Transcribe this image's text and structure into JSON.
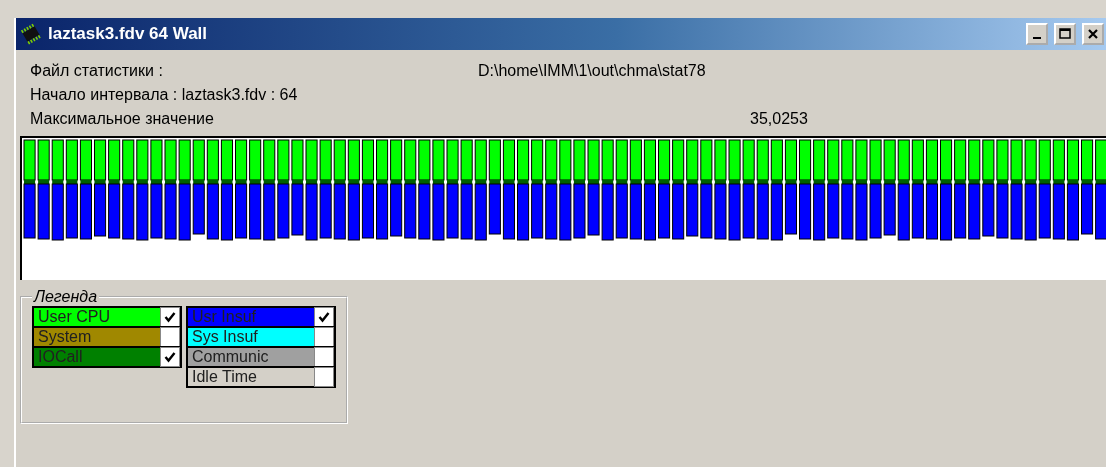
{
  "window": {
    "title": "laztask3.fdv 64 Wall"
  },
  "info": [
    {
      "kind": "pair",
      "label": "Файл статистики :",
      "value": "D:\\home\\IMM\\1\\out\\chma\\stat78"
    },
    {
      "kind": "single",
      "label": "Начало интервала : laztask3.fdv : 64"
    },
    {
      "kind": "far",
      "label": "Максимальное значение",
      "value": "35,0253"
    }
  ],
  "legend": {
    "title": "Легенда",
    "columns": [
      [
        {
          "name": "User CPU",
          "color": "#00ff00",
          "checked": true
        },
        {
          "name": "System",
          "color": "#a08800",
          "checked": false
        },
        {
          "name": "IOCall",
          "color": "#008000",
          "checked": true
        }
      ],
      [
        {
          "name": "Usr Insuf",
          "color": "#0000ff",
          "checked": true
        },
        {
          "name": "Sys Insuf",
          "color": "#00ffff",
          "checked": false
        },
        {
          "name": "Communic",
          "color": "#a0a0a0",
          "checked": false
        },
        {
          "name": "Idle Time",
          "color": "#d4d0c8",
          "checked": false
        }
      ]
    ]
  }
}
